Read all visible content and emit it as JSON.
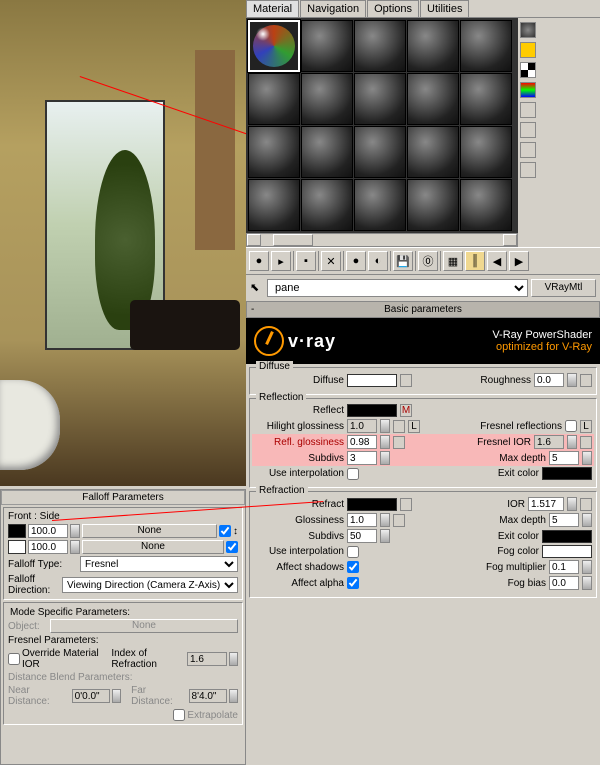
{
  "tabs": {
    "material": "Material",
    "navigation": "Navigation",
    "options": "Options",
    "utilities": "Utilities"
  },
  "material": {
    "name": "pane",
    "type": "VRayMtl"
  },
  "sections": {
    "basic": "Basic parameters"
  },
  "vray": {
    "brand": "v·ray",
    "title": "V-Ray PowerShader",
    "subtitle": "optimized for V-Ray"
  },
  "diffuse": {
    "group": "Diffuse",
    "label": "Diffuse",
    "roughness_label": "Roughness",
    "roughness": "0.0"
  },
  "reflection": {
    "group": "Reflection",
    "reflect_label": "Reflect",
    "reflect_map": "M",
    "hilight_label": "Hilight glossiness",
    "hilight": "1.0",
    "hilight_lock": "L",
    "refl_gloss_label": "Refl. glossiness",
    "refl_gloss": "0.98",
    "subdivs_label": "Subdivs",
    "subdivs": "3",
    "interp_label": "Use interpolation",
    "fresnel_label": "Fresnel reflections",
    "fresnel_lock": "L",
    "fresnel_ior_label": "Fresnel IOR",
    "fresnel_ior": "1.6",
    "maxdepth_label": "Max depth",
    "maxdepth": "5",
    "exit_label": "Exit color"
  },
  "refraction": {
    "group": "Refraction",
    "refract_label": "Refract",
    "gloss_label": "Glossiness",
    "gloss": "1.0",
    "subdivs_label": "Subdivs",
    "subdivs": "50",
    "interp_label": "Use interpolation",
    "shadows_label": "Affect shadows",
    "alpha_label": "Affect alpha",
    "ior_label": "IOR",
    "ior": "1.517",
    "maxdepth_label": "Max depth",
    "maxdepth": "5",
    "exit_label": "Exit color",
    "fogcolor_label": "Fog color",
    "fogmult_label": "Fog multiplier",
    "fogmult": "0.1",
    "fogbias_label": "Fog bias",
    "fogbias": "0.0"
  },
  "falloff": {
    "title": "Falloff Parameters",
    "frontside": "Front : Side",
    "amt1": "100.0",
    "map1": "None",
    "amt2": "100.0",
    "map2": "None",
    "type_label": "Falloff Type:",
    "type": "Fresnel",
    "dir_label": "Falloff Direction:",
    "dir": "Viewing Direction (Camera Z-Axis)",
    "mode_title": "Mode Specific Parameters:",
    "object_label": "Object:",
    "object_btn": "None",
    "fresnel_params": "Fresnel Parameters:",
    "override_label": "Override Material IOR",
    "ior_label": "Index of Refraction",
    "ior": "1.6",
    "dist_params": "Distance Blend Parameters:",
    "near_label": "Near Distance:",
    "near": "0'0.0\"",
    "far_label": "Far Distance:",
    "far": "8'4.0\"",
    "extrapolate_label": "Extrapolate",
    "swap_icon": "↕"
  }
}
